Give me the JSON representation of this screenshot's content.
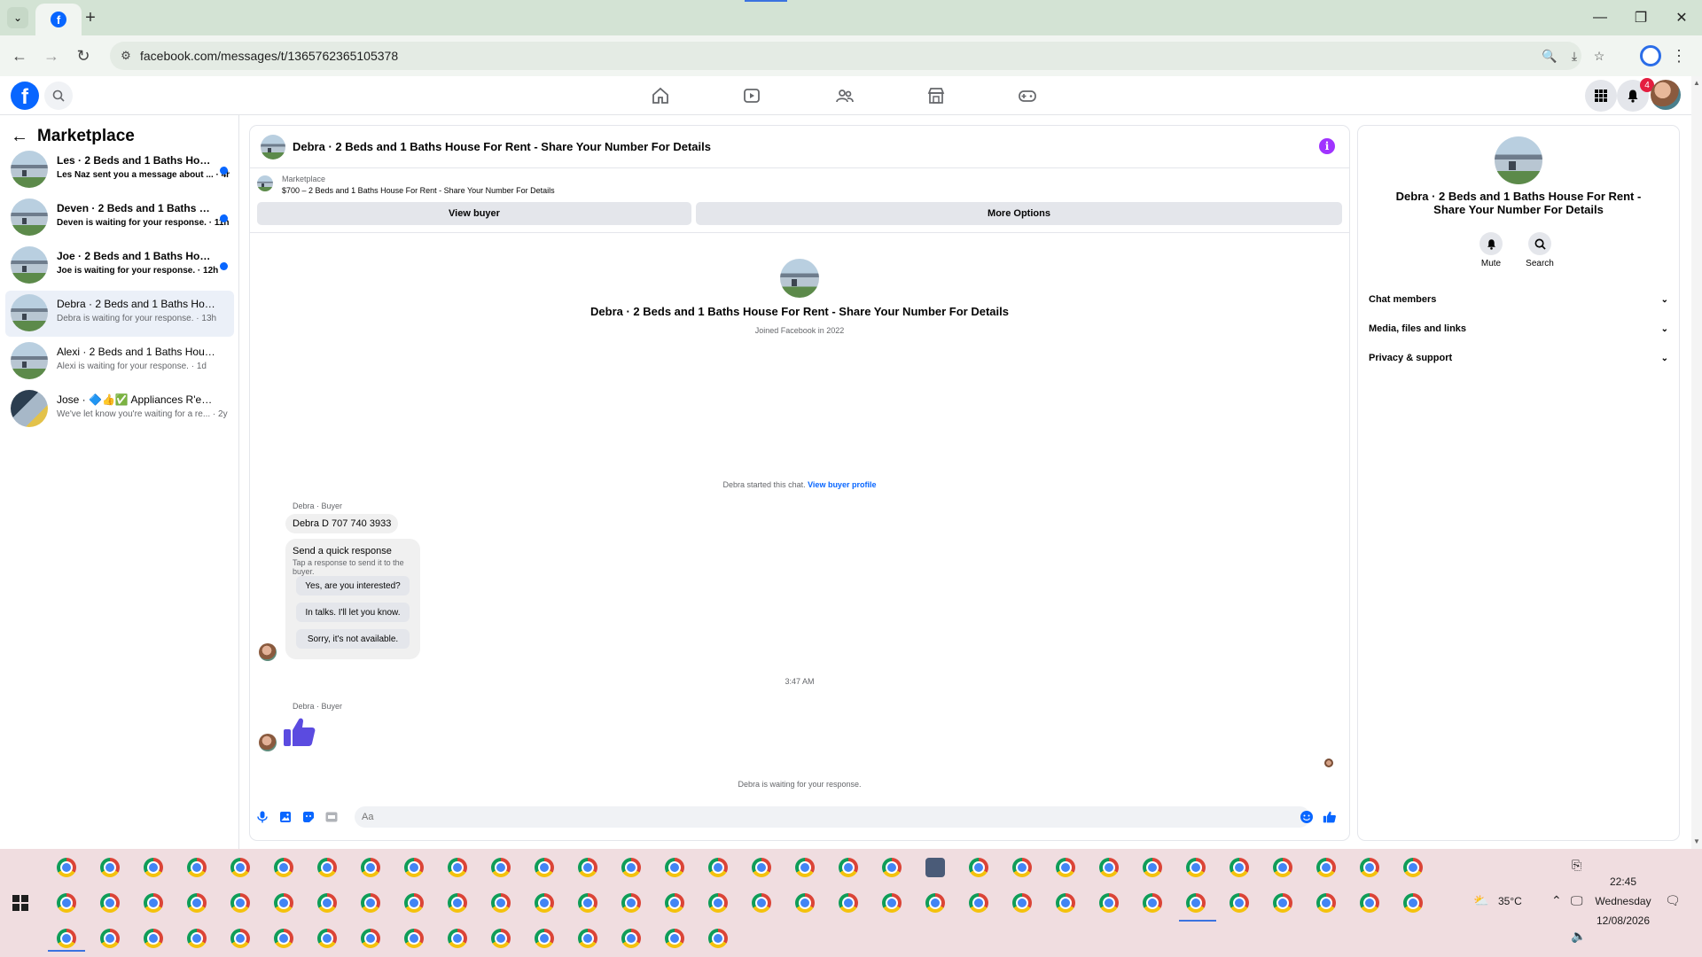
{
  "browser": {
    "url": "facebook.com/messages/t/1365762365105378",
    "new_tab": "+",
    "tab_dropdown": "⌄"
  },
  "sidebar": {
    "title": "Marketplace",
    "conversations": [
      {
        "name": "Les · 2 Beds and 1 Baths House F...",
        "preview": "Les Naz sent you a message about ... · 4h",
        "unread": true
      },
      {
        "name": "Deven · 2 Beds and 1 Baths Hous...",
        "preview": "Deven is waiting for your response. · 11h",
        "unread": true
      },
      {
        "name": "Joe · 2 Beds and 1 Baths House F...",
        "preview": "Joe is waiting for your response. · 12h",
        "unread": true
      },
      {
        "name": "Debra · 2 Beds and 1 Baths House ...",
        "preview": "Debra is waiting for your response. · 13h",
        "unread": false
      },
      {
        "name": "Alexi · 2 Beds and 1 Baths House F...",
        "preview": "Alexi is waiting for your response. · 1d",
        "unread": false
      },
      {
        "name": "Jose · 🔷👍✅ Appliances R'epair ...",
        "preview": "We've let know you're waiting for a re... · 2y",
        "unread": false
      }
    ]
  },
  "header": {
    "notification_count": "4"
  },
  "chat": {
    "title": "Debra · 2 Beds and 1 Baths House For Rent - Share Your Number For Details",
    "marketplace_label": "Marketplace",
    "listing": "$700 – 2 Beds and 1 Baths House For Rent - Share Your Number For Details",
    "view_buyer": "View buyer",
    "more_options": "More Options",
    "intro_title": "Debra · 2 Beds and 1 Baths House For Rent - Share Your Number For Details",
    "intro_sub": "Joined Facebook in 2022",
    "started_text": "Debra started this chat.",
    "view_buyer_profile": "View buyer profile",
    "sender_label": "Debra · Buyer",
    "message": "Debra D 707 740 3933",
    "quick_response_title": "Send a quick response",
    "quick_response_sub": "Tap a response to send it to the buyer.",
    "quick_responses": [
      "Yes, are you interested?",
      "In talks. I'll let you know.",
      "Sorry, it's not available."
    ],
    "timestamp": "3:47 AM",
    "waiting": "Debra is waiting for your response.",
    "composer_placeholder": "Aa"
  },
  "info_panel": {
    "title": "Debra · 2 Beds and 1 Baths House For Rent - Share Your Number For Details",
    "mute": "Mute",
    "search": "Search",
    "sections": [
      "Chat members",
      "Media, files and links",
      "Privacy & support"
    ]
  },
  "taskbar": {
    "temperature": "35°C",
    "time": "22:45",
    "day": "Wednesday",
    "date": "12/08/2026"
  },
  "colors": {
    "fb_blue": "#0866ff",
    "accent_purple": "#a033ff",
    "thumbs_up": "#5b4be0",
    "taskbar": "#f0dde0"
  }
}
